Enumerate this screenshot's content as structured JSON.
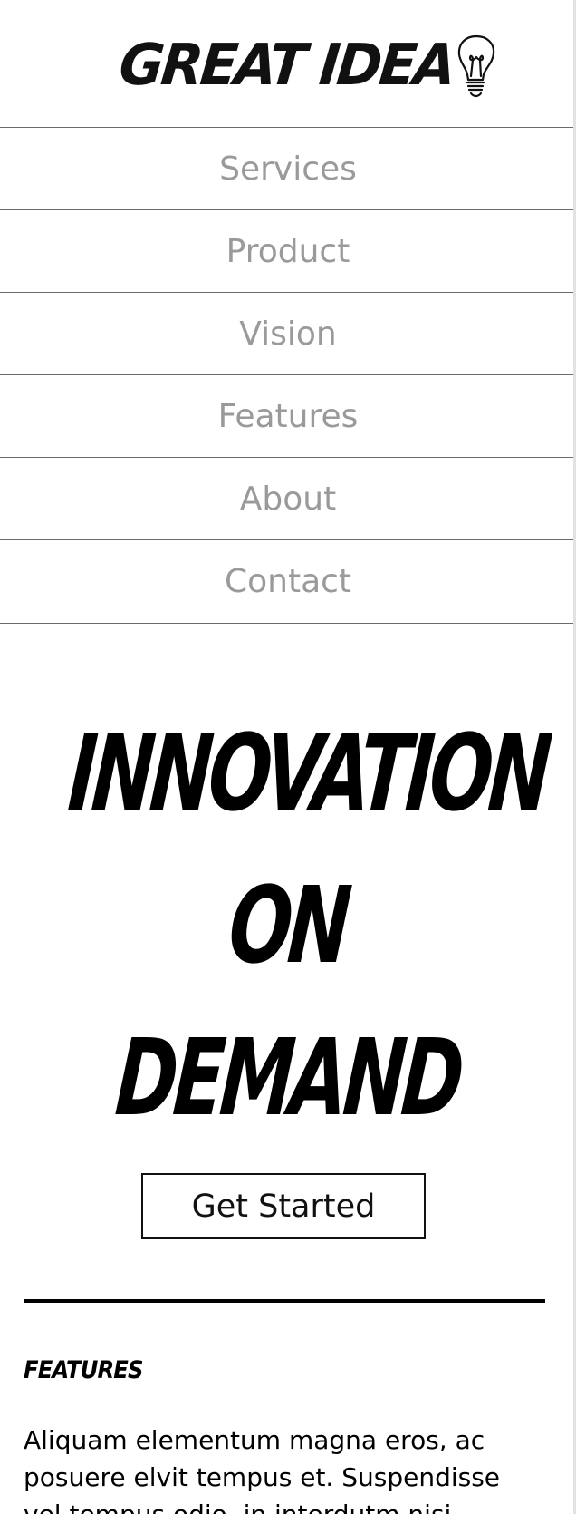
{
  "header": {
    "logo_text": "GREAT IDEA",
    "logo_icon": "lightbulb-icon"
  },
  "nav": {
    "items": [
      {
        "label": "Services"
      },
      {
        "label": "Product"
      },
      {
        "label": "Vision"
      },
      {
        "label": "Features"
      },
      {
        "label": "About"
      },
      {
        "label": "Contact"
      }
    ]
  },
  "hero": {
    "line1": "INNOVATION",
    "line2": "ON",
    "line3": "DEMAND",
    "cta_label": "Get Started"
  },
  "features": {
    "heading": "FEATURES",
    "body": "Aliquam elementum magna eros, ac posuere elvit tempus et. Suspendisse vel tempus odio, in interdutm nisi."
  },
  "colors": {
    "nav_text": "#9a9a9a",
    "nav_border": "#6b6b6b",
    "text": "#000000",
    "background": "#ffffff"
  }
}
